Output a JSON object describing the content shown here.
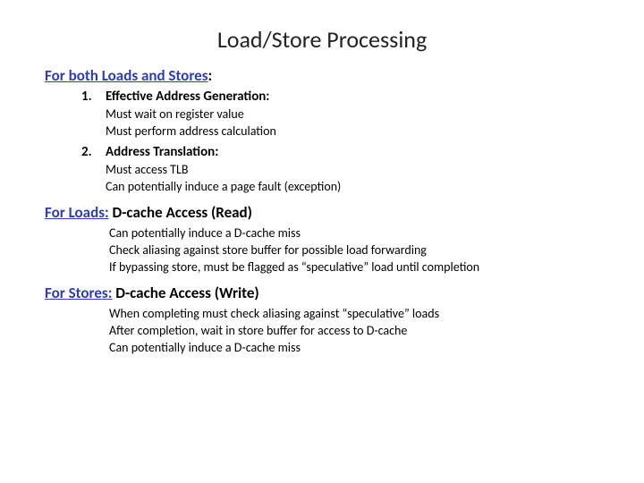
{
  "title": "Load/Store Processing",
  "section1": {
    "header_ul": "For both Loads and Stores",
    "header_suffix": ":",
    "items": [
      {
        "title": "Effective Address Generation:",
        "lines": [
          "Must wait on register value",
          "Must perform address calculation"
        ]
      },
      {
        "title": "Address Translation:",
        "lines": [
          "Must access TLB",
          "Can potentially induce a page fault (exception)"
        ]
      }
    ]
  },
  "section2": {
    "header_ul": "For Loads:",
    "header_suffix": " D-cache Access (Read)",
    "lines": [
      "Can potentially induce a D-cache miss",
      "Check aliasing against store buffer for possible load forwarding",
      "If bypassing store, must be flagged as “speculative” load until completion"
    ]
  },
  "section3": {
    "header_ul": "For Stores:",
    "header_suffix": " D-cache Access (Write)",
    "lines": [
      "When completing must check aliasing against “speculative” loads",
      "After completion, wait in store buffer for access to D-cache",
      "Can potentially induce a D-cache miss"
    ]
  }
}
